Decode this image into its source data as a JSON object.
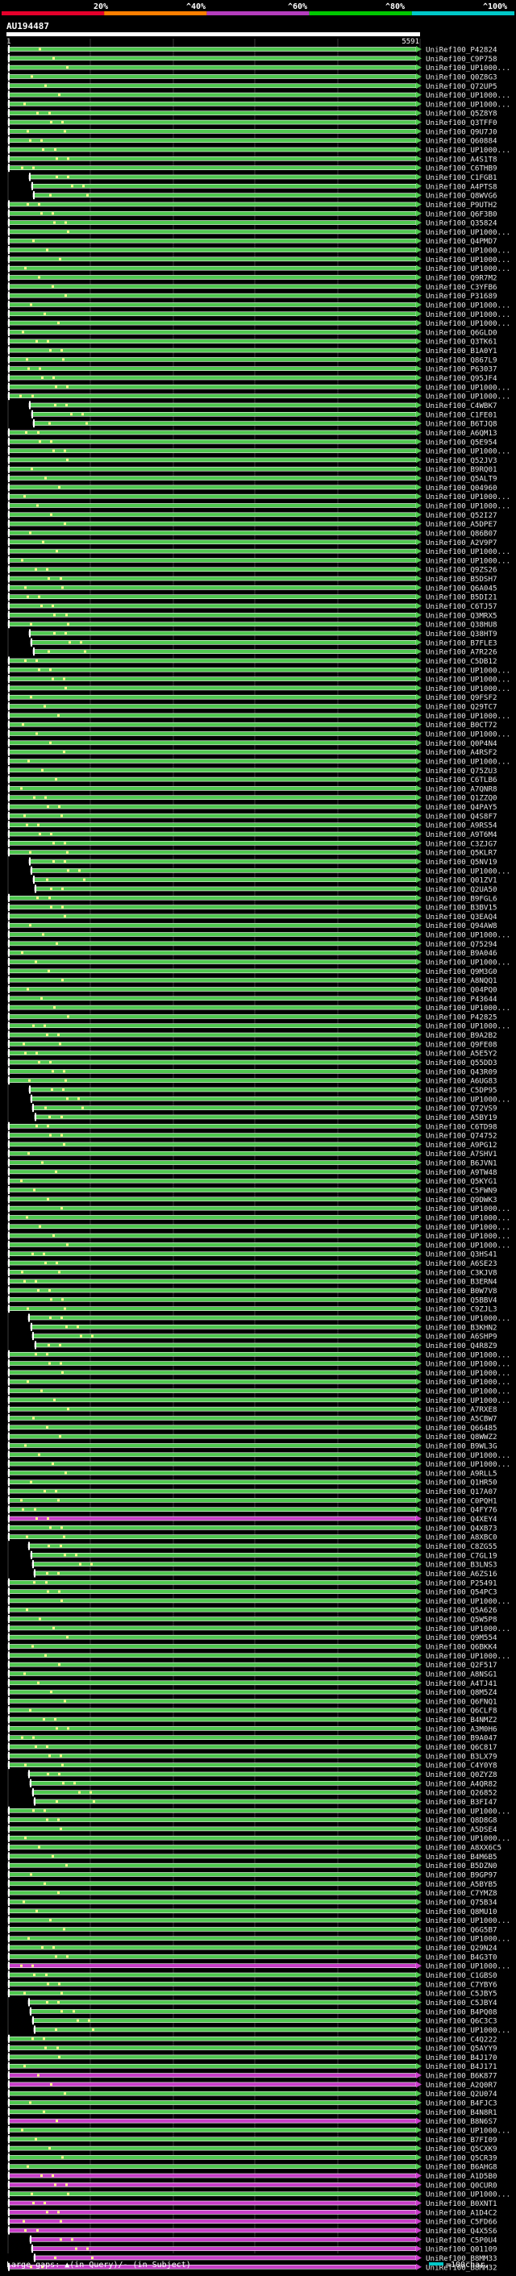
{
  "legend": {
    "labels": [
      "20%",
      "^40%",
      "^60%",
      "^80%",
      "^100%"
    ],
    "colors": [
      "#e5002b",
      "#ff7f00",
      "#b43ebe",
      "#00c800",
      "#00c8c8"
    ]
  },
  "query": {
    "name": "AU194487",
    "start": "1",
    "end": "5591"
  },
  "colors": {
    "background": "#000000",
    "gridline": "#3a3a3a",
    "hit_green": "#4fc84f",
    "hit_magenta": "#c83ec8",
    "hit_border": "#ffffff",
    "gap_dot": "#fffe8a",
    "scale_line": "#ffffff"
  },
  "hits": [
    {
      "label": "UniRef100_P42824",
      "color": "green"
    },
    {
      "label": "UniRef100_C9P758",
      "color": "green"
    },
    {
      "label": "UniRef100_UP1000...",
      "color": "green"
    },
    {
      "label": "UniRef100_Q0Z8G3",
      "color": "green"
    },
    {
      "label": "UniRef100_Q72UP5",
      "color": "green"
    },
    {
      "label": "UniRef100_UP1000...",
      "color": "green"
    },
    {
      "label": "UniRef100_UP1000...",
      "color": "green"
    },
    {
      "label": "UniRef100_Q5Z8Y8",
      "color": "green"
    },
    {
      "label": "UniRef100_Q3TFF0",
      "color": "green"
    },
    {
      "label": "UniRef100_Q9U7J0",
      "color": "green"
    },
    {
      "label": "UniRef100_Q60884",
      "color": "green"
    },
    {
      "label": "UniRef100_UP1000...",
      "color": "green"
    },
    {
      "label": "UniRef100_A4S1T8",
      "color": "green"
    },
    {
      "label": "UniRef100_C6THB9",
      "color": "green"
    },
    {
      "label": "UniRef100_C1FGB1",
      "color": "green"
    },
    {
      "label": "UniRef100_A4PTS8",
      "color": "green"
    },
    {
      "label": "UniRef100_Q8WVG6",
      "color": "green"
    },
    {
      "label": "UniRef100_P9UTH2",
      "color": "green"
    },
    {
      "label": "UniRef100_Q6F3B0",
      "color": "green"
    },
    {
      "label": "UniRef100_Q35824",
      "color": "green"
    },
    {
      "label": "UniRef100_UP1000...",
      "color": "green"
    },
    {
      "label": "UniRef100_Q4PMD7",
      "color": "green"
    },
    {
      "label": "UniRef100_UP1000...",
      "color": "green"
    },
    {
      "label": "UniRef100_UP1000...",
      "color": "green"
    },
    {
      "label": "UniRef100_UP1000...",
      "color": "green"
    },
    {
      "label": "UniRef100_Q9R7M2",
      "color": "green"
    },
    {
      "label": "UniRef100_C3YFB6",
      "color": "green"
    },
    {
      "label": "UniRef100_P31689",
      "color": "green"
    },
    {
      "label": "UniRef100_UP1000...",
      "color": "green"
    },
    {
      "label": "UniRef100_UP1000...",
      "color": "green"
    },
    {
      "label": "UniRef100_UP1000...",
      "color": "green"
    },
    {
      "label": "UniRef100_Q6GLD0",
      "color": "green"
    },
    {
      "label": "UniRef100_Q3TK61",
      "color": "green"
    },
    {
      "label": "UniRef100_B1A0Y1",
      "color": "green"
    },
    {
      "label": "UniRef100_Q867L9",
      "color": "green"
    },
    {
      "label": "UniRef100_P63037",
      "color": "green"
    },
    {
      "label": "UniRef100_Q95JF4",
      "color": "green"
    },
    {
      "label": "UniRef100_UP1000...",
      "color": "green"
    },
    {
      "label": "UniRef100_UP1000...",
      "color": "green"
    },
    {
      "label": "UniRef100_C4WBK7",
      "color": "green"
    },
    {
      "label": "UniRef100_C1FE01",
      "color": "green"
    },
    {
      "label": "UniRef100_B6TJQ8",
      "color": "green"
    },
    {
      "label": "UniRef100_A6QM13",
      "color": "green"
    },
    {
      "label": "UniRef100_Q5E954",
      "color": "green"
    },
    {
      "label": "UniRef100_UP1000...",
      "color": "green"
    },
    {
      "label": "UniRef100_Q52JV3",
      "color": "green"
    },
    {
      "label": "UniRef100_B9RQ01",
      "color": "green"
    },
    {
      "label": "UniRef100_Q5ALT9",
      "color": "green"
    },
    {
      "label": "UniRef100_Q04960",
      "color": "green"
    },
    {
      "label": "UniRef100_UP1000...",
      "color": "green"
    },
    {
      "label": "UniRef100_UP1000...",
      "color": "green"
    },
    {
      "label": "UniRef100_Q52I27",
      "color": "green"
    },
    {
      "label": "UniRef100_A5DPE7",
      "color": "green"
    },
    {
      "label": "UniRef100_Q86B07",
      "color": "green"
    },
    {
      "label": "UniRef100_A2V9P7",
      "color": "green"
    },
    {
      "label": "UniRef100_UP1000...",
      "color": "green"
    },
    {
      "label": "UniRef100_UP1000...",
      "color": "green"
    },
    {
      "label": "UniRef100_Q9ZS26",
      "color": "green"
    },
    {
      "label": "UniRef100_B5DSH7",
      "color": "green"
    },
    {
      "label": "UniRef100_Q6A045",
      "color": "green"
    },
    {
      "label": "UniRef100_B5DI21",
      "color": "green"
    },
    {
      "label": "UniRef100_C6TJ57",
      "color": "green"
    },
    {
      "label": "UniRef100_Q3MRX5",
      "color": "green"
    },
    {
      "label": "UniRef100_Q38HU8",
      "color": "green"
    },
    {
      "label": "UniRef100_Q38HT9",
      "color": "green"
    },
    {
      "label": "UniRef100_B7FLE3",
      "color": "green"
    },
    {
      "label": "UniRef100_A7R226",
      "color": "green"
    },
    {
      "label": "UniRef100_C5DB12",
      "color": "green"
    },
    {
      "label": "UniRef100_UP1000...",
      "color": "green"
    },
    {
      "label": "UniRef100_UP1000...",
      "color": "green"
    },
    {
      "label": "UniRef100_UP1000...",
      "color": "green"
    },
    {
      "label": "UniRef100_Q9FSF2",
      "color": "green"
    },
    {
      "label": "UniRef100_Q29TC7",
      "color": "green"
    },
    {
      "label": "UniRef100_UP1000...",
      "color": "green"
    },
    {
      "label": "UniRef100_B0CT72",
      "color": "green"
    },
    {
      "label": "UniRef100_UP1000...",
      "color": "green"
    },
    {
      "label": "UniRef100_Q0P4N4",
      "color": "green"
    },
    {
      "label": "UniRef100_A4RSF2",
      "color": "green"
    },
    {
      "label": "UniRef100_UP1000...",
      "color": "green"
    },
    {
      "label": "UniRef100_Q75ZU3",
      "color": "green"
    },
    {
      "label": "UniRef100_C6TLB6",
      "color": "green"
    },
    {
      "label": "UniRef100_A7QNR8",
      "color": "green"
    },
    {
      "label": "UniRef100_Q1ZZQ0",
      "color": "green"
    },
    {
      "label": "UniRef100_Q4PAY5",
      "color": "green"
    },
    {
      "label": "UniRef100_Q4S8F7",
      "color": "green"
    },
    {
      "label": "UniRef100_A9RS54",
      "color": "green"
    },
    {
      "label": "UniRef100_A9T6M4",
      "color": "green"
    },
    {
      "label": "UniRef100_C3ZJG7",
      "color": "green"
    },
    {
      "label": "UniRef100_Q5KLR7",
      "color": "green"
    },
    {
      "label": "UniRef100_Q5NV19",
      "color": "green"
    },
    {
      "label": "UniRef100_UP1000...",
      "color": "green"
    },
    {
      "label": "UniRef100_Q01ZV1",
      "color": "green"
    },
    {
      "label": "UniRef100_Q2UA50",
      "color": "green"
    },
    {
      "label": "UniRef100_B9FGL6",
      "color": "green"
    },
    {
      "label": "UniRef100_B3BV15",
      "color": "green"
    },
    {
      "label": "UniRef100_Q3EAQ4",
      "color": "green"
    },
    {
      "label": "UniRef100_Q94AW8",
      "color": "green"
    },
    {
      "label": "UniRef100_UP1000...",
      "color": "green"
    },
    {
      "label": "UniRef100_Q75294",
      "color": "green"
    },
    {
      "label": "UniRef100_B9A046",
      "color": "green"
    },
    {
      "label": "UniRef100_UP1000...",
      "color": "green"
    },
    {
      "label": "UniRef100_Q9M3G0",
      "color": "green"
    },
    {
      "label": "UniRef100_A8NQQ1",
      "color": "green"
    },
    {
      "label": "UniRef100_Q04PQ0",
      "color": "green"
    },
    {
      "label": "UniRef100_P43644",
      "color": "green"
    },
    {
      "label": "UniRef100_UP1000...",
      "color": "green"
    },
    {
      "label": "UniRef100_P42825",
      "color": "green"
    },
    {
      "label": "UniRef100_UP1000...",
      "color": "green"
    },
    {
      "label": "UniRef100_B9A2B2",
      "color": "green"
    },
    {
      "label": "UniRef100_Q9FE08",
      "color": "green"
    },
    {
      "label": "UniRef100_A5E5Y2",
      "color": "green"
    },
    {
      "label": "UniRef100_Q55DD3",
      "color": "green"
    },
    {
      "label": "UniRef100_Q43R09",
      "color": "green"
    },
    {
      "label": "UniRef100_A6UG83",
      "color": "green"
    },
    {
      "label": "UniRef100_C5DP95",
      "color": "green"
    },
    {
      "label": "UniRef100_UP1000...",
      "color": "green"
    },
    {
      "label": "UniRef100_Q72VS9",
      "color": "green"
    },
    {
      "label": "UniRef100_A5BY19",
      "color": "green"
    },
    {
      "label": "UniRef100_C6TD98",
      "color": "green"
    },
    {
      "label": "UniRef100_Q74752",
      "color": "green"
    },
    {
      "label": "UniRef100_A9PG12",
      "color": "green"
    },
    {
      "label": "UniRef100_A7SHV1",
      "color": "green"
    },
    {
      "label": "UniRef100_B6JVN1",
      "color": "green"
    },
    {
      "label": "UniRef100_A9TW48",
      "color": "green"
    },
    {
      "label": "UniRef100_Q5KYG1",
      "color": "green"
    },
    {
      "label": "UniRef100_C5FWN9",
      "color": "green"
    },
    {
      "label": "UniRef100_Q9DWK3",
      "color": "green"
    },
    {
      "label": "UniRef100_UP1000...",
      "color": "green"
    },
    {
      "label": "UniRef100_UP1000...",
      "color": "green"
    },
    {
      "label": "UniRef100_UP1000...",
      "color": "green"
    },
    {
      "label": "UniRef100_UP1000...",
      "color": "green"
    },
    {
      "label": "UniRef100_UP1000...",
      "color": "green"
    },
    {
      "label": "UniRef100_Q3HS41",
      "color": "green"
    },
    {
      "label": "UniRef100_A6SE23",
      "color": "green"
    },
    {
      "label": "UniRef100_C3KJV8",
      "color": "green"
    },
    {
      "label": "UniRef100_B3ERN4",
      "color": "green"
    },
    {
      "label": "UniRef100_B0W7V8",
      "color": "green"
    },
    {
      "label": "UniRef100_Q5BBV4",
      "color": "green"
    },
    {
      "label": "UniRef100_C9ZJL3",
      "color": "green"
    },
    {
      "label": "UniRef100_UP1000...",
      "color": "green"
    },
    {
      "label": "UniRef100_B3KHN2",
      "color": "green"
    },
    {
      "label": "UniRef100_A6SHP9",
      "color": "green"
    },
    {
      "label": "UniRef100_Q4R8Z9",
      "color": "green"
    },
    {
      "label": "UniRef100_UP1000...",
      "color": "green"
    },
    {
      "label": "UniRef100_UP1000...",
      "color": "green"
    },
    {
      "label": "UniRef100_UP1000...",
      "color": "green"
    },
    {
      "label": "UniRef100_UP1000...",
      "color": "green"
    },
    {
      "label": "UniRef100_UP1000...",
      "color": "green"
    },
    {
      "label": "UniRef100_UP1000...",
      "color": "green"
    },
    {
      "label": "UniRef100_A7RXE8",
      "color": "green"
    },
    {
      "label": "UniRef100_A5CBW7",
      "color": "green"
    },
    {
      "label": "UniRef100_Q66485",
      "color": "green"
    },
    {
      "label": "UniRef100_Q8WWZ2",
      "color": "green"
    },
    {
      "label": "UniRef100_B9WL3G",
      "color": "green"
    },
    {
      "label": "UniRef100_UP1000...",
      "color": "green"
    },
    {
      "label": "UniRef100_UP1000...",
      "color": "green"
    },
    {
      "label": "UniRef100_A9RLL5",
      "color": "green"
    },
    {
      "label": "UniRef100_Q1HR50",
      "color": "green"
    },
    {
      "label": "UniRef100_Q17A07",
      "color": "green"
    },
    {
      "label": "UniRef100_C0PQH1",
      "color": "green"
    },
    {
      "label": "UniRef100_Q4FY76",
      "color": "green"
    },
    {
      "label": "UniRef100_Q4XEY4",
      "color": "magenta"
    },
    {
      "label": "UniRef100_Q4XB73",
      "color": "green"
    },
    {
      "label": "UniRef100_A8XBC0",
      "color": "green"
    },
    {
      "label": "UniRef100_C8ZG55",
      "color": "green"
    },
    {
      "label": "UniRef100_C7GL19",
      "color": "green"
    },
    {
      "label": "UniRef100_B3LNS3",
      "color": "green"
    },
    {
      "label": "UniRef100_A6ZS16",
      "color": "green"
    },
    {
      "label": "UniRef100_P25491",
      "color": "green"
    },
    {
      "label": "UniRef100_Q54PC3",
      "color": "green"
    },
    {
      "label": "UniRef100_UP1000...",
      "color": "green"
    },
    {
      "label": "UniRef100_Q5A626",
      "color": "green"
    },
    {
      "label": "UniRef100_Q5W5P8",
      "color": "green"
    },
    {
      "label": "UniRef100_UP1000...",
      "color": "green"
    },
    {
      "label": "UniRef100_Q9M554",
      "color": "green"
    },
    {
      "label": "UniRef100_Q6BKK4",
      "color": "green"
    },
    {
      "label": "UniRef100_UP1000...",
      "color": "green"
    },
    {
      "label": "UniRef100_Q2F517",
      "color": "green"
    },
    {
      "label": "UniRef100_A8NSG1",
      "color": "green"
    },
    {
      "label": "UniRef100_A4TJ41",
      "color": "green"
    },
    {
      "label": "UniRef100_Q8M5Z4",
      "color": "green"
    },
    {
      "label": "UniRef100_Q6FNQ1",
      "color": "green"
    },
    {
      "label": "UniRef100_Q6CLF8",
      "color": "green"
    },
    {
      "label": "UniRef100_B4NMZ2",
      "color": "green"
    },
    {
      "label": "UniRef100_A3M0H6",
      "color": "green"
    },
    {
      "label": "UniRef100_B9A047",
      "color": "green"
    },
    {
      "label": "UniRef100_Q6C817",
      "color": "green"
    },
    {
      "label": "UniRef100_B3LX79",
      "color": "green"
    },
    {
      "label": "UniRef100_C4Y0Y8",
      "color": "green"
    },
    {
      "label": "UniRef100_Q0ZYZ8",
      "color": "green"
    },
    {
      "label": "UniRef100_A4QR82",
      "color": "green"
    },
    {
      "label": "UniRef100_Q26852",
      "color": "green"
    },
    {
      "label": "UniRef100_B3FI47",
      "color": "green"
    },
    {
      "label": "UniRef100_UP1000...",
      "color": "green"
    },
    {
      "label": "UniRef100_Q8D8G8",
      "color": "green"
    },
    {
      "label": "UniRef100_A5DSE4",
      "color": "green"
    },
    {
      "label": "UniRef100_UP1000...",
      "color": "green"
    },
    {
      "label": "UniRef100_A8XX6C5",
      "color": "green"
    },
    {
      "label": "UniRef100_B4M6B5",
      "color": "green"
    },
    {
      "label": "UniRef100_B5DZN0",
      "color": "green"
    },
    {
      "label": "UniRef100_B9GP97",
      "color": "green"
    },
    {
      "label": "UniRef100_A5BYB5",
      "color": "green"
    },
    {
      "label": "UniRef100_C7YMZ8",
      "color": "green"
    },
    {
      "label": "UniRef100_Q75B34",
      "color": "green"
    },
    {
      "label": "UniRef100_Q8MU10",
      "color": "green"
    },
    {
      "label": "UniRef100_UP1000...",
      "color": "green"
    },
    {
      "label": "UniRef100_Q6G5B7",
      "color": "green"
    },
    {
      "label": "UniRef100_UP1000...",
      "color": "green"
    },
    {
      "label": "UniRef100_Q29N24",
      "color": "green"
    },
    {
      "label": "UniRef100_B4G3T0",
      "color": "green"
    },
    {
      "label": "UniRef100_UP1000...",
      "color": "magenta"
    },
    {
      "label": "UniRef100_C1GBS0",
      "color": "green"
    },
    {
      "label": "UniRef100_C7YBY6",
      "color": "green"
    },
    {
      "label": "UniRef100_C5JBY5",
      "color": "green"
    },
    {
      "label": "UniRef100_C5JBY4",
      "color": "green"
    },
    {
      "label": "UniRef100_B4PQ08",
      "color": "green"
    },
    {
      "label": "UniRef100_Q6C3C3",
      "color": "green"
    },
    {
      "label": "UniRef100_UP1000...",
      "color": "green"
    },
    {
      "label": "UniRef100_C4Q222",
      "color": "green"
    },
    {
      "label": "UniRef100_Q5AYY9",
      "color": "green"
    },
    {
      "label": "UniRef100_B4J170",
      "color": "green"
    },
    {
      "label": "UniRef100_B4J171",
      "color": "green"
    },
    {
      "label": "UniRef100_B6K877",
      "color": "magenta"
    },
    {
      "label": "UniRef100_A2Q0R7",
      "color": "magenta"
    },
    {
      "label": "UniRef100_Q2U074",
      "color": "green"
    },
    {
      "label": "UniRef100_B4FJC3",
      "color": "green"
    },
    {
      "label": "UniRef100_B4N8R1",
      "color": "green"
    },
    {
      "label": "UniRef100_B8N6S7",
      "color": "magenta"
    },
    {
      "label": "UniRef100_UP1000...",
      "color": "green"
    },
    {
      "label": "UniRef100_B7FI09",
      "color": "green"
    },
    {
      "label": "UniRef100_Q5CXK9",
      "color": "green"
    },
    {
      "label": "UniRef100_Q5CR39",
      "color": "green"
    },
    {
      "label": "UniRef100_B6AHG8",
      "color": "green"
    },
    {
      "label": "UniRef100_A1D5B0",
      "color": "magenta"
    },
    {
      "label": "UniRef100_Q0CUR0",
      "color": "magenta"
    },
    {
      "label": "UniRef100_UP1000...",
      "color": "green"
    },
    {
      "label": "UniRef100_B0XNT1",
      "color": "magenta"
    },
    {
      "label": "UniRef100_A1D4C2",
      "color": "magenta"
    },
    {
      "label": "UniRef100_C5FD66",
      "color": "magenta"
    },
    {
      "label": "UniRef100_Q4X5S6",
      "color": "magenta"
    },
    {
      "label": "UniRef100_C5P0U4",
      "color": "magenta"
    },
    {
      "label": "UniRef100_Q01109",
      "color": "magenta"
    },
    {
      "label": "UniRef100_B8MM33",
      "color": "magenta"
    },
    {
      "label": "UniRef100_B8MM32",
      "color": "magenta"
    }
  ],
  "footer": {
    "gaps_text": "Large gaps: ▲(in Query)/- (in Subject)",
    "scale_text": "=100char."
  }
}
